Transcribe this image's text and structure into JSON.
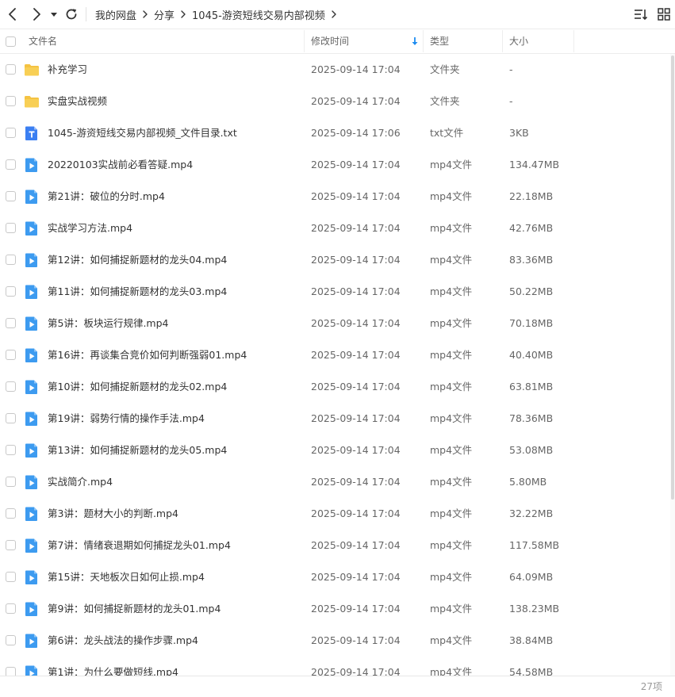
{
  "nav": {
    "back_icon": "chevron-left-icon",
    "forward_icon": "chevron-right-icon",
    "history_icon": "caret-down-icon",
    "refresh_icon": "refresh-icon"
  },
  "breadcrumb": [
    "我的网盘",
    "分享",
    "1045-游资短线交易内部视频"
  ],
  "toolbar": {
    "sort_icon": "sort-list-icon",
    "view_icon": "grid-view-icon"
  },
  "header": {
    "name": "文件名",
    "time": "修改时间",
    "type": "类型",
    "size": "大小",
    "sort_indicator": "sort-desc-arrow-icon"
  },
  "colors": {
    "folder": "#f5c342",
    "video": "#3d9bf0",
    "txt": "#3b7ff2",
    "sort_arrow": "#1e8cf0"
  },
  "files": [
    {
      "name": "补充学习",
      "time": "2025-09-14 17:04",
      "type": "文件夹",
      "size": "-",
      "icon": "folder-icon"
    },
    {
      "name": "实盘实战视频",
      "time": "2025-09-14 17:04",
      "type": "文件夹",
      "size": "-",
      "icon": "folder-icon"
    },
    {
      "name": "1045-游资短线交易内部视频_文件目录.txt",
      "time": "2025-09-14 17:06",
      "type": "txt文件",
      "size": "3KB",
      "icon": "text-file-icon"
    },
    {
      "name": "20220103实战前必看答疑.mp4",
      "time": "2025-09-14 17:04",
      "type": "mp4文件",
      "size": "134.47MB",
      "icon": "video-file-icon"
    },
    {
      "name": "第21讲：破位的分时.mp4",
      "time": "2025-09-14 17:04",
      "type": "mp4文件",
      "size": "22.18MB",
      "icon": "video-file-icon"
    },
    {
      "name": "实战学习方法.mp4",
      "time": "2025-09-14 17:04",
      "type": "mp4文件",
      "size": "42.76MB",
      "icon": "video-file-icon"
    },
    {
      "name": "第12讲：如何捕捉新题材的龙头04.mp4",
      "time": "2025-09-14 17:04",
      "type": "mp4文件",
      "size": "83.36MB",
      "icon": "video-file-icon"
    },
    {
      "name": "第11讲：如何捕捉新题材的龙头03.mp4",
      "time": "2025-09-14 17:04",
      "type": "mp4文件",
      "size": "50.22MB",
      "icon": "video-file-icon"
    },
    {
      "name": "第5讲：板块运行规律.mp4",
      "time": "2025-09-14 17:04",
      "type": "mp4文件",
      "size": "70.18MB",
      "icon": "video-file-icon"
    },
    {
      "name": "第16讲：再谈集合竞价如何判断强弱01.mp4",
      "time": "2025-09-14 17:04",
      "type": "mp4文件",
      "size": "40.40MB",
      "icon": "video-file-icon"
    },
    {
      "name": "第10讲：如何捕捉新题材的龙头02.mp4",
      "time": "2025-09-14 17:04",
      "type": "mp4文件",
      "size": "63.81MB",
      "icon": "video-file-icon"
    },
    {
      "name": "第19讲：弱势行情的操作手法.mp4",
      "time": "2025-09-14 17:04",
      "type": "mp4文件",
      "size": "78.36MB",
      "icon": "video-file-icon"
    },
    {
      "name": "第13讲：如何捕捉新题材的龙头05.mp4",
      "time": "2025-09-14 17:04",
      "type": "mp4文件",
      "size": "53.08MB",
      "icon": "video-file-icon"
    },
    {
      "name": "实战简介.mp4",
      "time": "2025-09-14 17:04",
      "type": "mp4文件",
      "size": "5.80MB",
      "icon": "video-file-icon"
    },
    {
      "name": "第3讲：题材大小的判断.mp4",
      "time": "2025-09-14 17:04",
      "type": "mp4文件",
      "size": "32.22MB",
      "icon": "video-file-icon"
    },
    {
      "name": "第7讲：情绪衰退期如何捕捉龙头01.mp4",
      "time": "2025-09-14 17:04",
      "type": "mp4文件",
      "size": "117.58MB",
      "icon": "video-file-icon"
    },
    {
      "name": "第15讲：天地板次日如何止损.mp4",
      "time": "2025-09-14 17:04",
      "type": "mp4文件",
      "size": "64.09MB",
      "icon": "video-file-icon"
    },
    {
      "name": "第9讲：如何捕捉新题材的龙头01.mp4",
      "time": "2025-09-14 17:04",
      "type": "mp4文件",
      "size": "138.23MB",
      "icon": "video-file-icon"
    },
    {
      "name": "第6讲：龙头战法的操作步骤.mp4",
      "time": "2025-09-14 17:04",
      "type": "mp4文件",
      "size": "38.84MB",
      "icon": "video-file-icon"
    },
    {
      "name": "第1讲：为什么要做短线.mp4",
      "time": "2025-09-14 17:04",
      "type": "mp4文件",
      "size": "54.58MB",
      "icon": "video-file-icon"
    }
  ],
  "footer": {
    "count": "27项"
  }
}
